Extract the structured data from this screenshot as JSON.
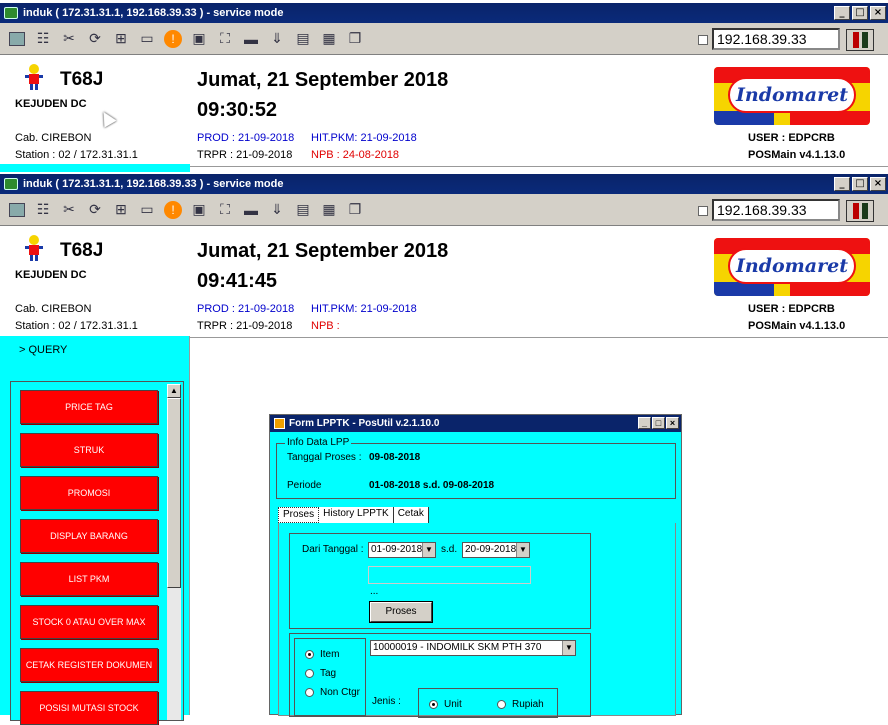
{
  "windows": [
    {
      "title": "induk ( 172.31.31.1, 192.168.39.33 ) - service mode",
      "ip": "192.168.39.33",
      "store_code": "T68J",
      "branch": "KEJUDEN DC",
      "date": "Jumat, 21 September 2018",
      "time": "09:30:52",
      "cab": "Cab. CIREBON",
      "station": "Station : 02 / 172.31.31.1",
      "prod": "PROD : 21-09-2018",
      "hit": "HIT.PKM: 21-09-2018",
      "trpr": "TRPR : 21-09-2018",
      "npb": "NPB : 24-08-2018",
      "user": "USER : EDPCRB",
      "posmain": "POSMain v4.1.13.0",
      "logo": "Indomaret"
    },
    {
      "title": "induk ( 172.31.31.1, 192.168.39.33 ) - service mode",
      "ip": "192.168.39.33",
      "store_code": "T68J",
      "branch": "KEJUDEN DC",
      "date": "Jumat, 21 September 2018",
      "time": "09:41:45",
      "cab": "Cab. CIREBON",
      "station": "Station : 02 / 172.31.31.1",
      "prod": "PROD : 21-09-2018",
      "hit": "HIT.PKM: 21-09-2018",
      "trpr": "TRPR : 21-09-2018",
      "npb": "NPB :",
      "user": "USER : EDPCRB",
      "posmain": "POSMain v4.1.13.0",
      "logo": "Indomaret"
    }
  ],
  "window_buttons": {
    "minimize": "_",
    "maximize": "□",
    "close": "×"
  },
  "toolbar_icons": [
    "chart-icon",
    "tree-icon",
    "tools-icon",
    "refresh-icon",
    "windows-icon",
    "drive-icon",
    "alert-icon",
    "network-error-icon",
    "fullscreen-icon",
    "monitor-icon",
    "download-icon",
    "note-icon",
    "chip-icon",
    "copy-icon"
  ],
  "sidebar": {
    "query_label": "> QUERY",
    "menu": [
      "PRICE TAG",
      "STRUK",
      "PROMOSI",
      "DISPLAY BARANG",
      "LIST PKM",
      "STOCK 0 ATAU OVER MAX",
      "CETAK REGISTER DOKUMEN",
      "POSISI MUTASI STOCK"
    ]
  },
  "form": {
    "title": "Form LPPTK - PosUtil v.2.1.10.0",
    "info_group": "Info Data LPP",
    "tanggal_proses_label": "Tanggal Proses :",
    "tanggal_proses_value": "09-08-2018",
    "periode_label": "Periode",
    "periode_value": "01-08-2018 s.d. 09-08-2018",
    "tabs": [
      "Proses",
      "History LPPTK",
      "Cetak"
    ],
    "dari_tanggal_label": "Dari Tanggal :",
    "dari_tanggal_value": "01-09-2018",
    "sd_label": "s.d.",
    "sd_value": "20-09-2018",
    "dots": "...",
    "proses_button": "Proses",
    "radio_item": "Item",
    "radio_tag": "Tag",
    "radio_nonctgr": "Non Ctgr",
    "item_value": "10000019 - INDOMILK SKM PTH 370",
    "jenis_label": "Jenis :",
    "radio_unit": "Unit",
    "radio_rupiah": "Rupiah"
  },
  "colors": {
    "cyan": "#00ffff",
    "menu_red": "#ff0000",
    "title_blue": "#0a246a"
  }
}
